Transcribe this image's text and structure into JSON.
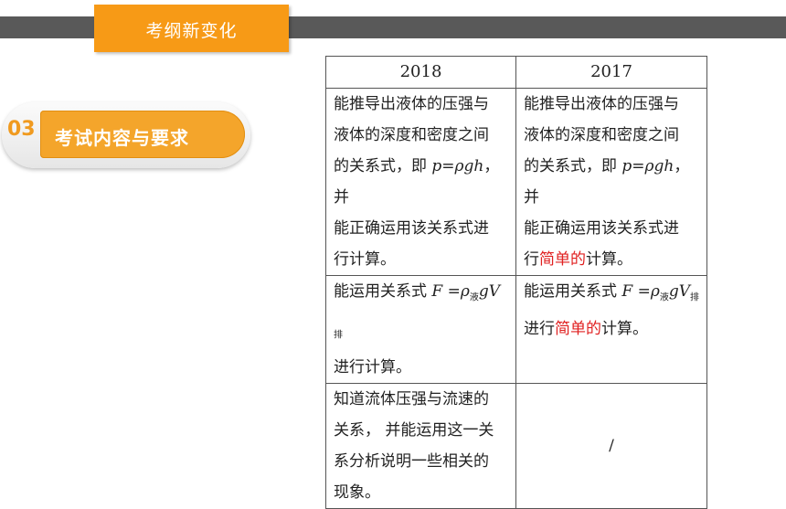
{
  "header": {
    "title": "考纲新变化"
  },
  "section": {
    "number": "03",
    "label": "考试内容与要求"
  },
  "table": {
    "headers": [
      "2018",
      "2017"
    ],
    "rows": [
      {
        "y2018": {
          "l1": "能推导出液体的压强与",
          "l2": "液体的深度和密度之间",
          "l3a": "的关系式，即 ",
          "l3f": "p=ρgh",
          "l3b": "，并",
          "l4": "能正确运用该关系式进",
          "l5": "行计算。"
        },
        "y2017": {
          "l1": "能推导出液体的压强与",
          "l2": "液体的深度和密度之间",
          "l3a": "的关系式，即 ",
          "l3f": "p=ρgh",
          "l3b": "，并",
          "l4": "能正确运用该关系式进",
          "l5a": "行",
          "l5r": "简单的",
          "l5b": "计算。"
        }
      },
      {
        "y2018": {
          "l1a": "能运用关系式 ",
          "l1f": "F =ρ",
          "l1s1": "液",
          "l1g": "gV",
          "l1s2": "排",
          "l2": "进行计算。"
        },
        "y2017": {
          "l1a": "能运用关系式 ",
          "l1f": "F =ρ",
          "l1s1": "液",
          "l1g": "gV",
          "l1s2": "排",
          "l2a": "进行",
          "l2r": "简单的",
          "l2b": "计算。"
        }
      },
      {
        "y2018": {
          "l1": "知道流体压强与流速的",
          "l2": "关系， 并能运用这一关",
          "l3": "系分析说明一些相关的",
          "l4": "现象。"
        },
        "y2017": {
          "text": "/"
        }
      }
    ]
  }
}
